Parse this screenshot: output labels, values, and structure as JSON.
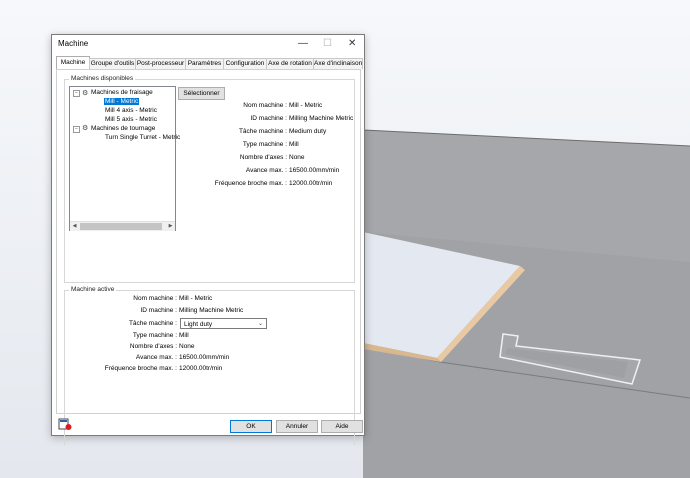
{
  "dialog": {
    "title": "Machine",
    "tabs": [
      "Machine",
      "Groupe d'outils",
      "Post-processeur",
      "Paramètres",
      "Configuration",
      "Axe de rotation",
      "Axe d'inclinaison"
    ],
    "available": {
      "group_label": "Machines disponibles",
      "tree": {
        "mill_group": "Machines de fraisage",
        "mill_items": [
          "Mill - Metric",
          "Mill 4 axis - Metric",
          "Mill 5 axis - Metric"
        ],
        "turn_group": "Machines de tournage",
        "turn_items": [
          "Turn Single Turret - Metric"
        ]
      },
      "select_button": "Sélectionner",
      "details": [
        {
          "label": "Nom machine :",
          "value": "Mill - Metric"
        },
        {
          "label": "ID machine :",
          "value": "Milling Machine Metric"
        },
        {
          "label": "Tâche machine :",
          "value": "Medium duty"
        },
        {
          "label": "Type machine :",
          "value": "Mill"
        },
        {
          "label": "Nombre d'axes :",
          "value": "None"
        },
        {
          "label": "Avance max. :",
          "value": "16500.00mm/min"
        },
        {
          "label": "Fréquence broche max. :",
          "value": "12000.00tr/min"
        }
      ]
    },
    "active": {
      "group_label": "Machine active",
      "details": [
        {
          "label": "Nom machine :",
          "value": "Mill - Metric"
        },
        {
          "label": "ID machine :",
          "value": "Milling Machine Metric"
        },
        {
          "label": "Tâche machine :",
          "value": "Light duty"
        },
        {
          "label": "Type machine :",
          "value": "Mill"
        },
        {
          "label": "Nombre d'axes :",
          "value": "None"
        },
        {
          "label": "Avance max. :",
          "value": "16500.00mm/min"
        },
        {
          "label": "Fréquence broche max. :",
          "value": "12000.00tr/min"
        }
      ]
    },
    "buttons": {
      "ok": "OK",
      "cancel": "Annuler",
      "help": "Aide"
    }
  }
}
